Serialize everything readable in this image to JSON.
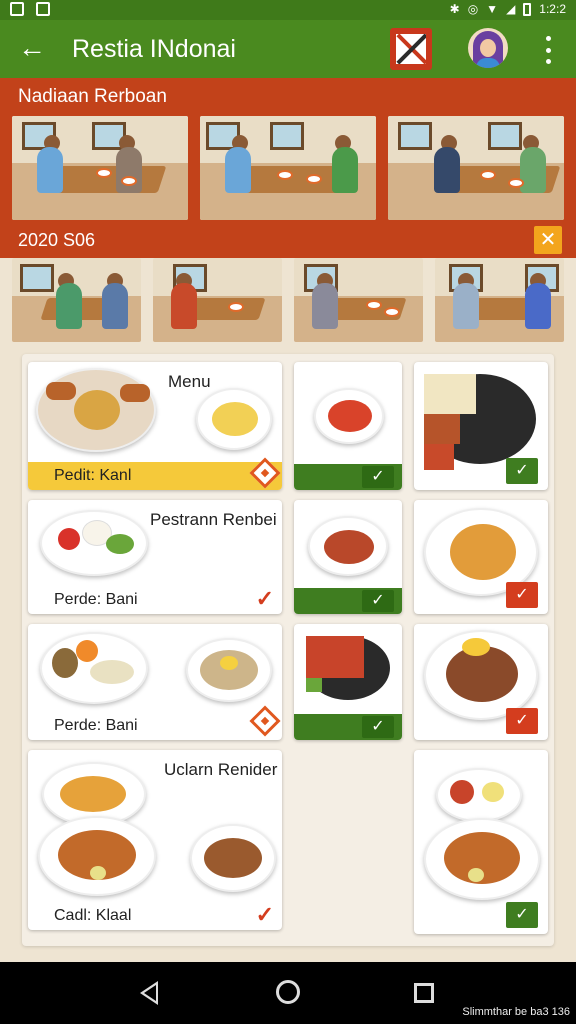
{
  "statusbar": {
    "time": "1:2:2"
  },
  "appbar": {
    "title": "Restia INdonai"
  },
  "banner": {
    "title": "Nadiaan Rerboan",
    "code": "2020 S06",
    "close_symbol": "✕"
  },
  "menu": {
    "cards": [
      {
        "label": "Menu",
        "footer": "Pedit: Kanl"
      },
      {
        "label": "Pestrann Renbei",
        "footer": "Perde: Bani"
      },
      {
        "footer": "Perde: Bani"
      },
      {
        "label": "Uclarn Renider",
        "footer": "Cadl: Klaal"
      }
    ],
    "check_symbol": "✓"
  },
  "navbar": {
    "watermark": "Slimmthar be ba3 136"
  },
  "colors": {
    "primary": "#4a8a1f",
    "accent": "#c2421a",
    "check": "#3f7d20",
    "alert": "#d43d1e"
  }
}
